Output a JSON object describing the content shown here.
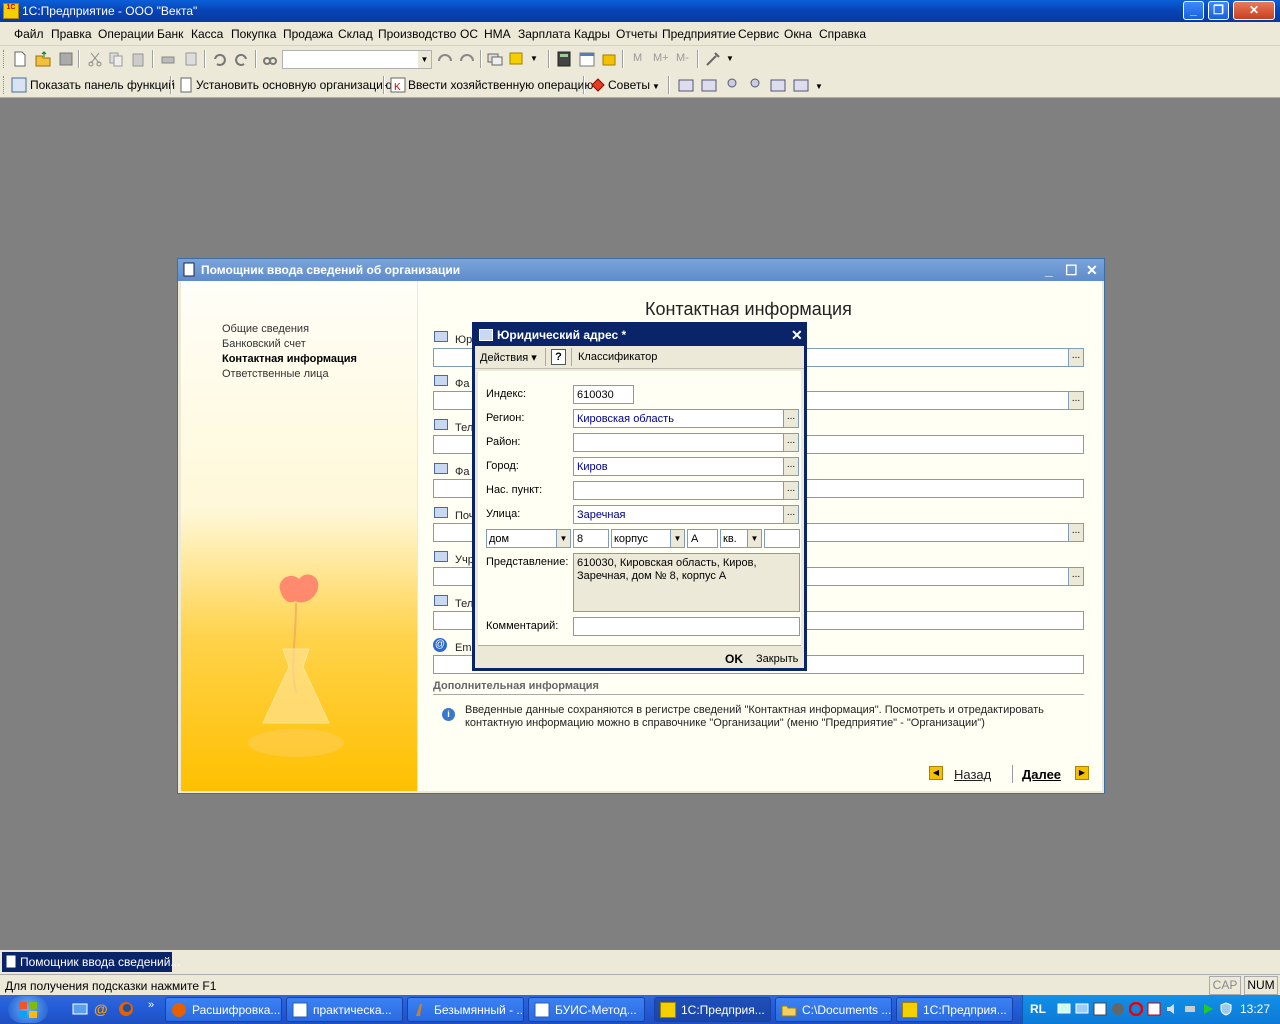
{
  "app": {
    "title": "1С:Предприятие - ООО \"Векта\"",
    "icon_text": "1C"
  },
  "menu": [
    "Файл",
    "Правка",
    "Операции",
    "Банк",
    "Касса",
    "Покупка",
    "Продажа",
    "Склад",
    "Производство",
    "ОС",
    "НМА",
    "Зарплата",
    "Кадры",
    "Отчеты",
    "Предприятие",
    "Сервис",
    "Окна",
    "Справка"
  ],
  "toolbar2": {
    "show_panel": "Показать панель функций",
    "set_org": "Установить основную организацию",
    "enter_op": "Ввести хозяйственную операцию",
    "tips": "Советы"
  },
  "memory_buttons": [
    "M",
    "M+",
    "M-"
  ],
  "wizard": {
    "title": "Помощник ввода сведений об организации",
    "nav": [
      "Общие сведения",
      "Банковский счет",
      "Контактная информация",
      "Ответственные лица"
    ],
    "heading": "Контактная информация",
    "fields": [
      "Юри",
      "Фа",
      "Тел",
      "Фа",
      "Поч",
      "Учр",
      "Тел",
      "Ema"
    ],
    "additional_title": "Дополнительная информация",
    "info_text_1": "Введенные данные сохраняются в регистре сведений \"Контактная информация\". Посмотреть и отредактировать",
    "info_text_2": "контактную информацию можно в справочнике \"Организации\" (меню \"Предприятие\" - \"Организации\")",
    "back": "Назад",
    "next": "Далее"
  },
  "dialog": {
    "title": "Юридический адрес *",
    "actions": "Действия",
    "help": "?",
    "classifier": "Классификатор",
    "labels": {
      "index": "Индекс:",
      "region": "Регион:",
      "district": "Район:",
      "city": "Город:",
      "settlement": "Нас. пункт:",
      "street": "Улица:",
      "view": "Представление:",
      "comment": "Комментарий:"
    },
    "values": {
      "index": "610030",
      "region": "Кировская область",
      "district": "",
      "city": "Киров",
      "settlement": "",
      "street": "Заречная",
      "house_type": "дом",
      "house": "8",
      "building_type": "корпус",
      "building": "А",
      "apt_type": "кв.",
      "apt": "",
      "view_1": "610030, Кировская область, Киров,",
      "view_2": "Заречная, дом № 8, корпус А",
      "comment": ""
    },
    "ok": "OK",
    "close": "Закрыть"
  },
  "open_window": "Помощник ввода сведений...",
  "status": {
    "hint": "Для получения подсказки нажмите F1",
    "cap": "CAP",
    "num": "NUM"
  },
  "taskbar": {
    "items": [
      "Расшифровка...",
      "практическа...",
      "Безымянный - ...",
      "БУИС-Метод...",
      "1С:Предприя...",
      "C:\\Documents ...",
      "1С:Предприя..."
    ],
    "lang": "RL",
    "clock": "13:27"
  },
  "colors": {
    "title_blue": "#0a246a",
    "xp_blue": "#245edb",
    "field_text": "#00008b"
  }
}
